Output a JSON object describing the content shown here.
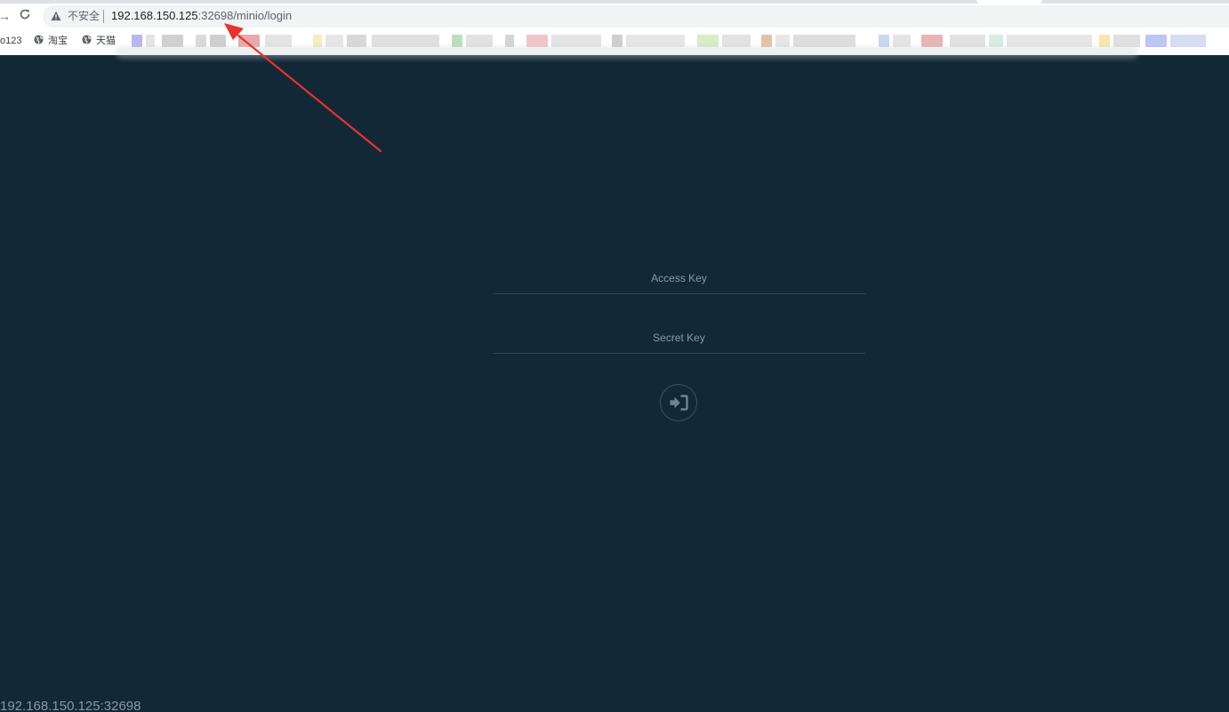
{
  "browser": {
    "nav": {
      "forward_icon": "arrow-right-icon",
      "reload_icon": "reload-icon"
    },
    "address_bar": {
      "security_icon": "warning-triangle-icon",
      "security_label": "不安全",
      "url_host": "192.168.150.125",
      "url_port": ":32698",
      "url_path": "/minio/login"
    },
    "bookmarks": [
      {
        "label": "o123"
      },
      {
        "label": "淘宝",
        "icon": "globe-icon"
      },
      {
        "label": "天猫",
        "icon": "globe-icon"
      }
    ],
    "status_url": "192.168.150.125:32698"
  },
  "login": {
    "access_key_placeholder": "Access Key",
    "secret_key_placeholder": "Secret Key",
    "submit_icon": "sign-in-icon"
  },
  "annotation": {
    "arrow_color": "#e8332c"
  },
  "theme": {
    "background": "#122837",
    "field_border": "#2f4554",
    "placeholder": "#8a9aa5"
  }
}
